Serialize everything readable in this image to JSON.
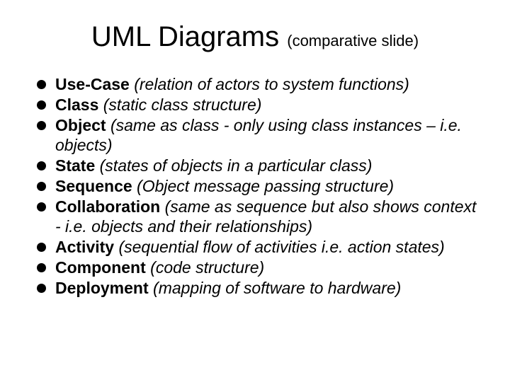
{
  "title": {
    "main": "UML Diagrams ",
    "sub": "(comparative slide)"
  },
  "items": [
    {
      "name": "Use-Case",
      "desc": " (relation of actors to system functions)"
    },
    {
      "name": "Class",
      "desc": " (static class structure)"
    },
    {
      "name": "Object",
      "desc": " (same as class - only using class instances – i.e. objects)"
    },
    {
      "name": "State",
      "desc": " (states of objects in a particular class)"
    },
    {
      "name": "Sequence",
      "desc": " (Object message passing structure)"
    },
    {
      "name": "Collaboration",
      "desc": " (same as sequence but also shows context - i.e. objects and their relationships)"
    },
    {
      "name": "Activity",
      "desc": " (sequential flow of activities i.e. action states)"
    },
    {
      "name": "Component",
      "desc": " (code structure)"
    },
    {
      "name": "Deployment",
      "desc": " (mapping of software to hardware)"
    }
  ]
}
